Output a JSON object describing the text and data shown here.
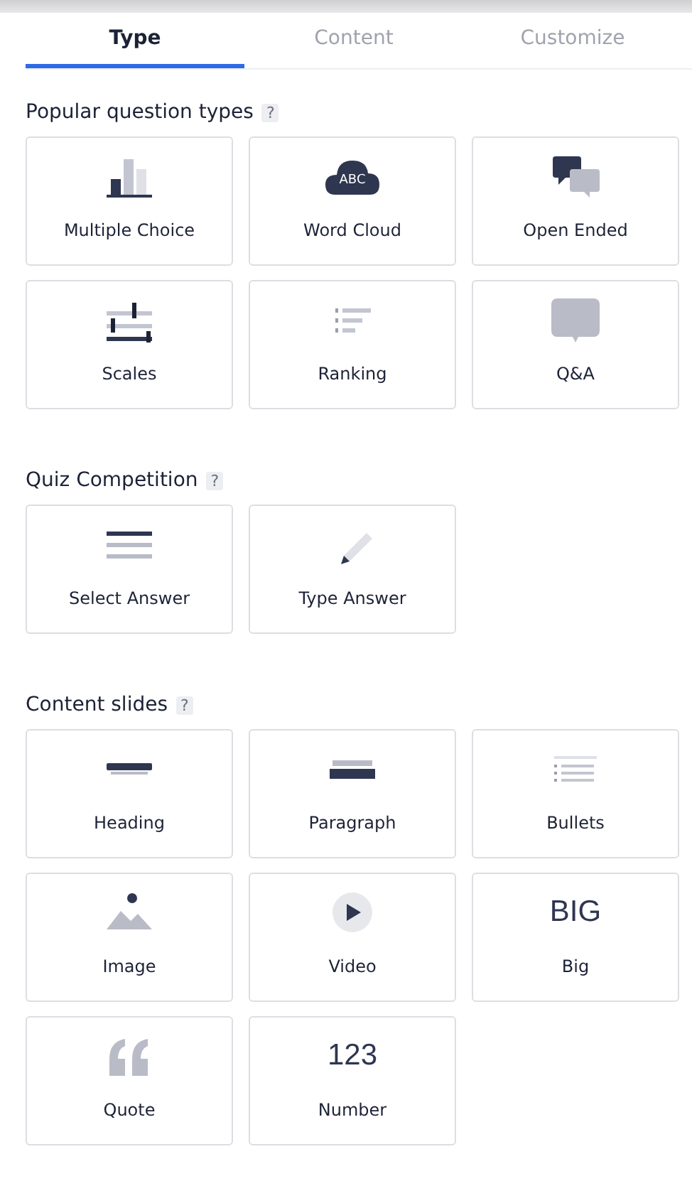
{
  "tabs": [
    {
      "label": "Type",
      "selected": true
    },
    {
      "label": "Content",
      "selected": false
    },
    {
      "label": "Customize",
      "selected": false
    }
  ],
  "sections": [
    {
      "title": "Popular question types",
      "help": "?",
      "tiles": [
        {
          "kind": "bars",
          "label": "Multiple Choice"
        },
        {
          "kind": "cloud",
          "glyph": "ABC",
          "label": "Word Cloud"
        },
        {
          "kind": "bubbles",
          "label": "Open Ended"
        },
        {
          "kind": "scales",
          "label": "Scales"
        },
        {
          "kind": "ranking",
          "label": "Ranking"
        },
        {
          "kind": "speech",
          "label": "Q&A"
        }
      ]
    },
    {
      "title": "Quiz Competition",
      "help": "?",
      "tiles": [
        {
          "kind": "lines",
          "label": "Select Answer"
        },
        {
          "kind": "pencil",
          "label": "Type Answer"
        }
      ]
    },
    {
      "title": "Content slides",
      "help": "?",
      "tiles": [
        {
          "kind": "heading",
          "label": "Heading"
        },
        {
          "kind": "paragraph",
          "label": "Paragraph"
        },
        {
          "kind": "bullets",
          "label": "Bullets"
        },
        {
          "kind": "image",
          "label": "Image"
        },
        {
          "kind": "video",
          "label": "Video"
        },
        {
          "kind": "text",
          "glyph": "BIG",
          "label": "Big"
        },
        {
          "kind": "quote",
          "label": "Quote"
        },
        {
          "kind": "text",
          "glyph": "123",
          "label": "Number"
        }
      ]
    }
  ]
}
